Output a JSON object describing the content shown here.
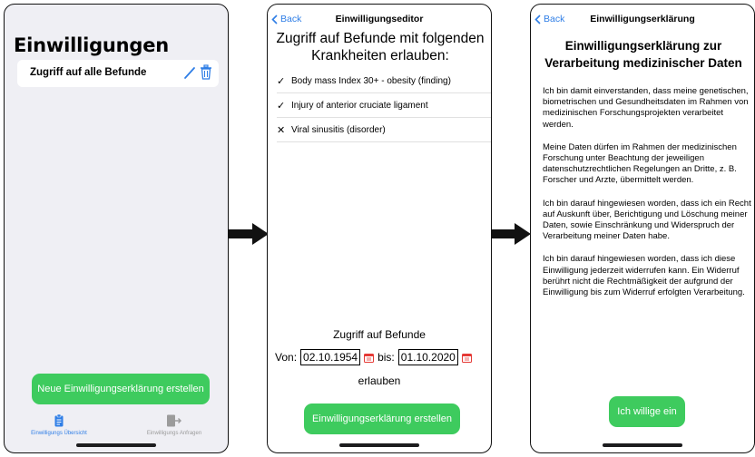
{
  "overview": {
    "title": "Einwilligungen",
    "card_label": "Zugriff auf alle Befunde",
    "create_button": "Neue Einwilligungserklärung erstellen",
    "tabs": [
      {
        "label": "Einwilligungs Übersicht",
        "icon": "clipboard-icon",
        "active": true
      },
      {
        "label": "Einwilligungs Anfragen",
        "icon": "door-arrow-icon",
        "active": false
      }
    ]
  },
  "editor": {
    "back_label": "Back",
    "nav_title": "Einwilligungseditor",
    "heading": "Zugriff auf Befunde mit folgenden Krankheiten erlauben:",
    "items": [
      {
        "mark": "✓",
        "label": "Body mass Index 30+ - obesity (finding)"
      },
      {
        "mark": "✓",
        "label": "Injury of anterior cruciate ligament"
      },
      {
        "mark": "✕",
        "label": "Viral sinusitis (disorder)"
      }
    ],
    "range_title": "Zugriff auf Befunde",
    "from_label": "Von:",
    "from_date": "02.10.1954",
    "to_label": "bis:",
    "to_date": "01.10.2020",
    "allow_label": "erlauben",
    "create_button": "Einwilligungserklärung erstellen"
  },
  "declaration": {
    "back_label": "Back",
    "nav_title": "Einwilligungserklärung",
    "heading": "Einwilligungserklärung zur Verarbeitung medizinischer Daten",
    "paragraphs": [
      "Ich bin damit einverstanden, dass meine genetischen, biometrischen und Gesundheitsdaten im Rahmen von medizinischen Forschungsprojekten verarbeitet werden.",
      "Meine Daten dürfen im Rahmen der medizinischen Forschung unter Beachtung der jeweiligen datenschutzrechtlichen Regelungen an Dritte, z. B. Forscher und Arzte, übermittelt werden.",
      "Ich bin darauf hingewiesen worden, dass ich ein Recht auf Auskunft über, Berichtigung und Löschung meiner Daten, sowie Einschränkung und Widerspruch der Verarbeitung meiner Daten habe.",
      "Ich bin darauf hingewiesen worden, dass ich diese Einwilligung jederzeit widerrufen kann. Ein Widerruf berührt nicht die Rechtmäßigkeit der aufgrund der Einwilligung bis zum Widerruf erfolgten Verarbeitung."
    ],
    "accept_button": "Ich willige ein"
  },
  "colors": {
    "accent": "#2f7ee6",
    "button": "#3ecb5e",
    "danger": "#e53935"
  }
}
